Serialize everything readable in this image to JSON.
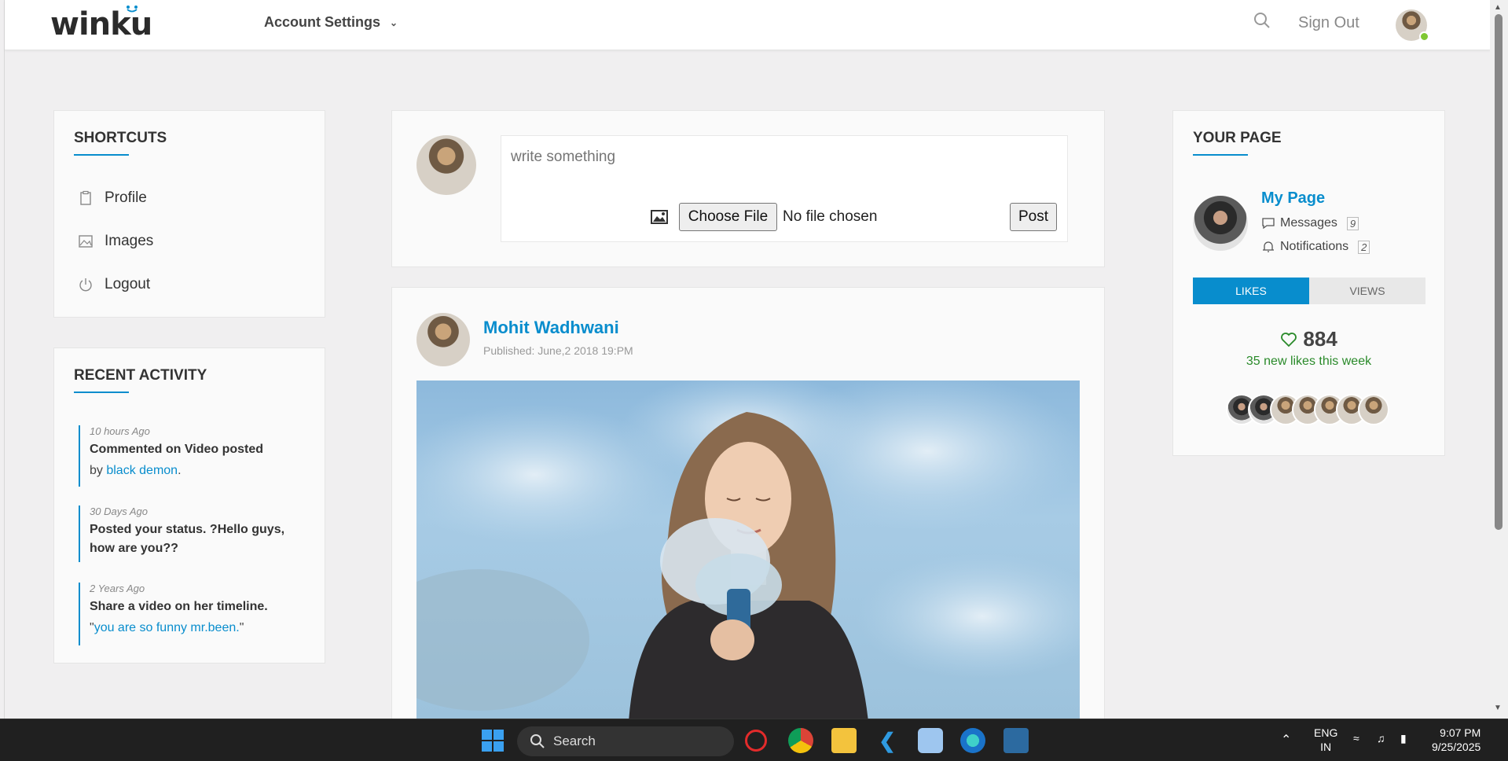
{
  "header": {
    "logo": "winku",
    "account_menu": "Account Settings",
    "sign_out": "Sign Out"
  },
  "shortcuts": {
    "title": "SHORTCUTS",
    "items": [
      {
        "label": "Profile",
        "icon": "clipboard-icon"
      },
      {
        "label": "Images",
        "icon": "image-icon"
      },
      {
        "label": "Logout",
        "icon": "power-icon"
      }
    ]
  },
  "recent_activity": {
    "title": "RECENT ACTIVITY",
    "items": [
      {
        "time": "10 hours Ago",
        "text": "Commented on Video posted",
        "sub_prefix": "by ",
        "sub_link": "black demon",
        "sub_suffix": "."
      },
      {
        "time": "30 Days Ago",
        "text": "Posted your status. ?Hello guys, how are you??"
      },
      {
        "time": "2 Years Ago",
        "text": "Share a video on her timeline.",
        "sub_prefix": "\"",
        "sub_link": "you are so funny mr.been.",
        "sub_suffix": "\""
      }
    ]
  },
  "composer": {
    "placeholder": "write something",
    "choose_file": "Choose File",
    "file_status": "No file chosen",
    "post": "Post"
  },
  "post": {
    "author": "Mohit Wadhwani",
    "published": "Published: June,2 2018 19:PM"
  },
  "your_page": {
    "title": "YOUR PAGE",
    "page_name": "My Page",
    "messages_label": "Messages",
    "messages_count": "9",
    "notifications_label": "Notifications",
    "notifications_count": "2",
    "tab_likes": "LIKES",
    "tab_views": "VIEWS",
    "likes_count": "884",
    "likes_sub": "35 new likes this week"
  },
  "taskbar": {
    "search": "Search",
    "lang_1": "ENG",
    "lang_2": "IN",
    "time": "9:07 PM",
    "date": "9/25/2025"
  },
  "colors": {
    "accent": "#088dcd",
    "online": "#7fc832",
    "likes_green": "#2a8a2a"
  }
}
